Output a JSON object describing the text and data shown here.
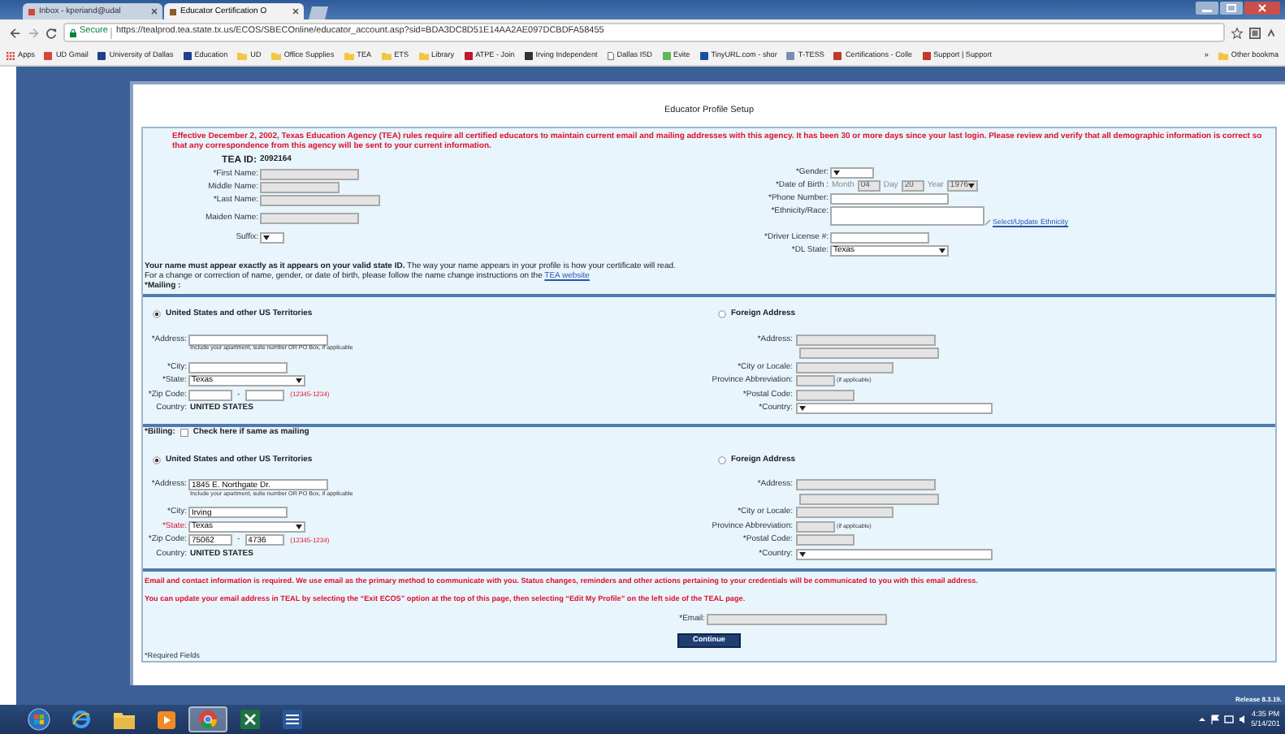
{
  "browser": {
    "tabs": [
      {
        "label": "Inbox - kperiand@udal",
        "selected": false
      },
      {
        "label": "Educator Certification O",
        "selected": true
      }
    ],
    "secure_label": "Secure",
    "url": "https://tealprod.tea.state.tx.us/ECOS/SBECOnline/educator_account.asp?sid=BDA3DC8D51E14AA2AE097DCBDFA58455",
    "bookmarks": [
      {
        "label": "Apps",
        "kind": "apps"
      },
      {
        "label": "UD Gmail",
        "kind": "site",
        "color": "#d44638"
      },
      {
        "label": "University of Dallas",
        "kind": "site",
        "color": "#1f3f8f"
      },
      {
        "label": "Education",
        "kind": "site",
        "color": "#1f3f8f"
      },
      {
        "label": "UD",
        "kind": "folder"
      },
      {
        "label": "Office Supplies",
        "kind": "folder"
      },
      {
        "label": "TEA",
        "kind": "folder"
      },
      {
        "label": "ETS",
        "kind": "folder"
      },
      {
        "label": "Library",
        "kind": "folder"
      },
      {
        "label": "ATPE - Join",
        "kind": "site",
        "color": "#c0182e"
      },
      {
        "label": "Irving Independent",
        "kind": "site",
        "color": "#333333"
      },
      {
        "label": "Dallas ISD",
        "kind": "page"
      },
      {
        "label": "Evite",
        "kind": "site",
        "color": "#5cb85c"
      },
      {
        "label": "TinyURL.com - shor",
        "kind": "site",
        "color": "#1a4fa0"
      },
      {
        "label": "T-TESS",
        "kind": "site",
        "color": "#7a8fb0"
      },
      {
        "label": "Certifications - Colle",
        "kind": "site",
        "color": "#c0392b"
      },
      {
        "label": "Support | Support",
        "kind": "site",
        "color": "#c0392b"
      }
    ],
    "overflow": "»",
    "other_bookmarks": "Other bookma"
  },
  "page": {
    "title": "Educator Profile Setup",
    "notice": "Effective December 2, 2002, Texas Education Agency (TEA) rules require all certified educators to maintain current email and mailing addresses with this agency. It has been 30 or more days since your last login. Please review and verify that all demographic information is correct so that any correspondence from this agency will be sent to your current information.",
    "tea_id": {
      "label": "TEA ID:",
      "value": "2092164"
    },
    "left_fields": [
      {
        "label": "*First Name:",
        "kind": "input",
        "disabled": true
      },
      {
        "label": "Middle Name:",
        "kind": "input",
        "disabled": true
      },
      {
        "label": "*Last Name:",
        "kind": "input",
        "disabled": true
      },
      {
        "label": "Maiden Name:",
        "kind": "input",
        "disabled": true
      },
      {
        "label": "Suffix:",
        "kind": "select",
        "disabled": false
      }
    ],
    "right_fields": [
      {
        "label": "*Gender:",
        "kind": "select",
        "disabled": false
      },
      {
        "label": "*Date of Birth :",
        "kind": "date",
        "disabled": true,
        "parts": [
          {
            "label": "Month",
            "value": "04"
          },
          {
            "label": "Day",
            "value": "20"
          },
          {
            "label": "Year",
            "value": "1976"
          }
        ]
      },
      {
        "label": "*Phone Number:",
        "kind": "input",
        "disabled": false
      },
      {
        "label": "*Ethnicity/Race:",
        "kind": "textarea",
        "disabled": false,
        "link": "Select/Update Ethnicity"
      },
      {
        "label": "*Driver License #:",
        "kind": "input",
        "disabled": false
      },
      {
        "label": "*DL State:",
        "kind": "select",
        "disabled": false,
        "value": "Texas"
      }
    ],
    "name_notice": "**Your name must appear exactly as it appears on your valid state ID.** The way your name appears in your profile is how your certificate will read.",
    "name_change": "For a change or correction of name, gender, or date of birth, please follow the name change instructions on the",
    "name_link": "TEA website",
    "mailing": {
      "label": "*Mailing :",
      "us": {
        "label": "United States and other US Territories",
        "selected": true,
        "address_label": "*Address:",
        "help": "Include your apartment, suite number OR PO Box, if applicable",
        "city_label": "*City:",
        "state_label": "*State:",
        "state": "Texas",
        "state_error": false,
        "zip_label": "*Zip Code:",
        "zip_separator": "-",
        "zip_hint": "(12345-1234)",
        "country_label": "Country:",
        "country": "UNITED STATES"
      },
      "foreign": {
        "label": "Foreign Address",
        "selected": false,
        "address_label": "*Address:",
        "city_label": "*City or Locale:",
        "province_label": "Province Abbreviation:",
        "province_hint": "(if applicable)",
        "postal_label": "*Postal Code:",
        "country_label": "*Country:"
      }
    },
    "billing": {
      "label": "*Billing:",
      "same_as_mailing": {
        "label": "Check here if same as mailing",
        "checked": false
      },
      "us": {
        "label": "United States and other US Territories",
        "selected": true,
        "address_label": "*Address:",
        "address": "1845 E. Northgate Dr.",
        "help": "Include your apartment, suite number OR PO Box, if applicable",
        "city_label": "*City:",
        "city": "Irving",
        "state_label": "*State:",
        "state": "Texas",
        "state_error": true,
        "zip_label": "*Zip Code:",
        "zip_separator": "-",
        "zip": "75062",
        "zip_ext": "4736",
        "zip_hint": "(12345-1234)",
        "country_label": "Country:",
        "country": "UNITED STATES"
      },
      "foreign": {
        "label": "Foreign Address",
        "selected": false,
        "address_label": "*Address:",
        "city_label": "*City or Locale:",
        "province_label": "Province Abbreviation:",
        "province_hint": "(if applicable)",
        "postal_label": "*Postal Code:",
        "country_label": "*Country:"
      }
    },
    "email_notices": [
      "Email and contact information is required. We use email as the primary method to communicate with you. Status changes, reminders and other actions pertaining to your credentials will be communicated to you with this email address.",
      "You can update your email address in TEAL by selecting the “Exit ECOS” option at the top of this page, then selecting “Edit My Profile” on the left side of the TEAL page."
    ],
    "email": {
      "label": "*Email:",
      "disabled": true
    },
    "continue": "Continue",
    "required_note": "*Required Fields",
    "release": "Release 8.3.19."
  },
  "taskbar": {
    "buttons": [
      {
        "selected": false
      },
      {
        "selected": false
      },
      {
        "selected": false
      },
      {
        "selected": false
      },
      {
        "selected": true
      },
      {
        "selected": false
      },
      {
        "selected": false
      }
    ],
    "time": "4:35 PM",
    "date": "5/14/201"
  }
}
